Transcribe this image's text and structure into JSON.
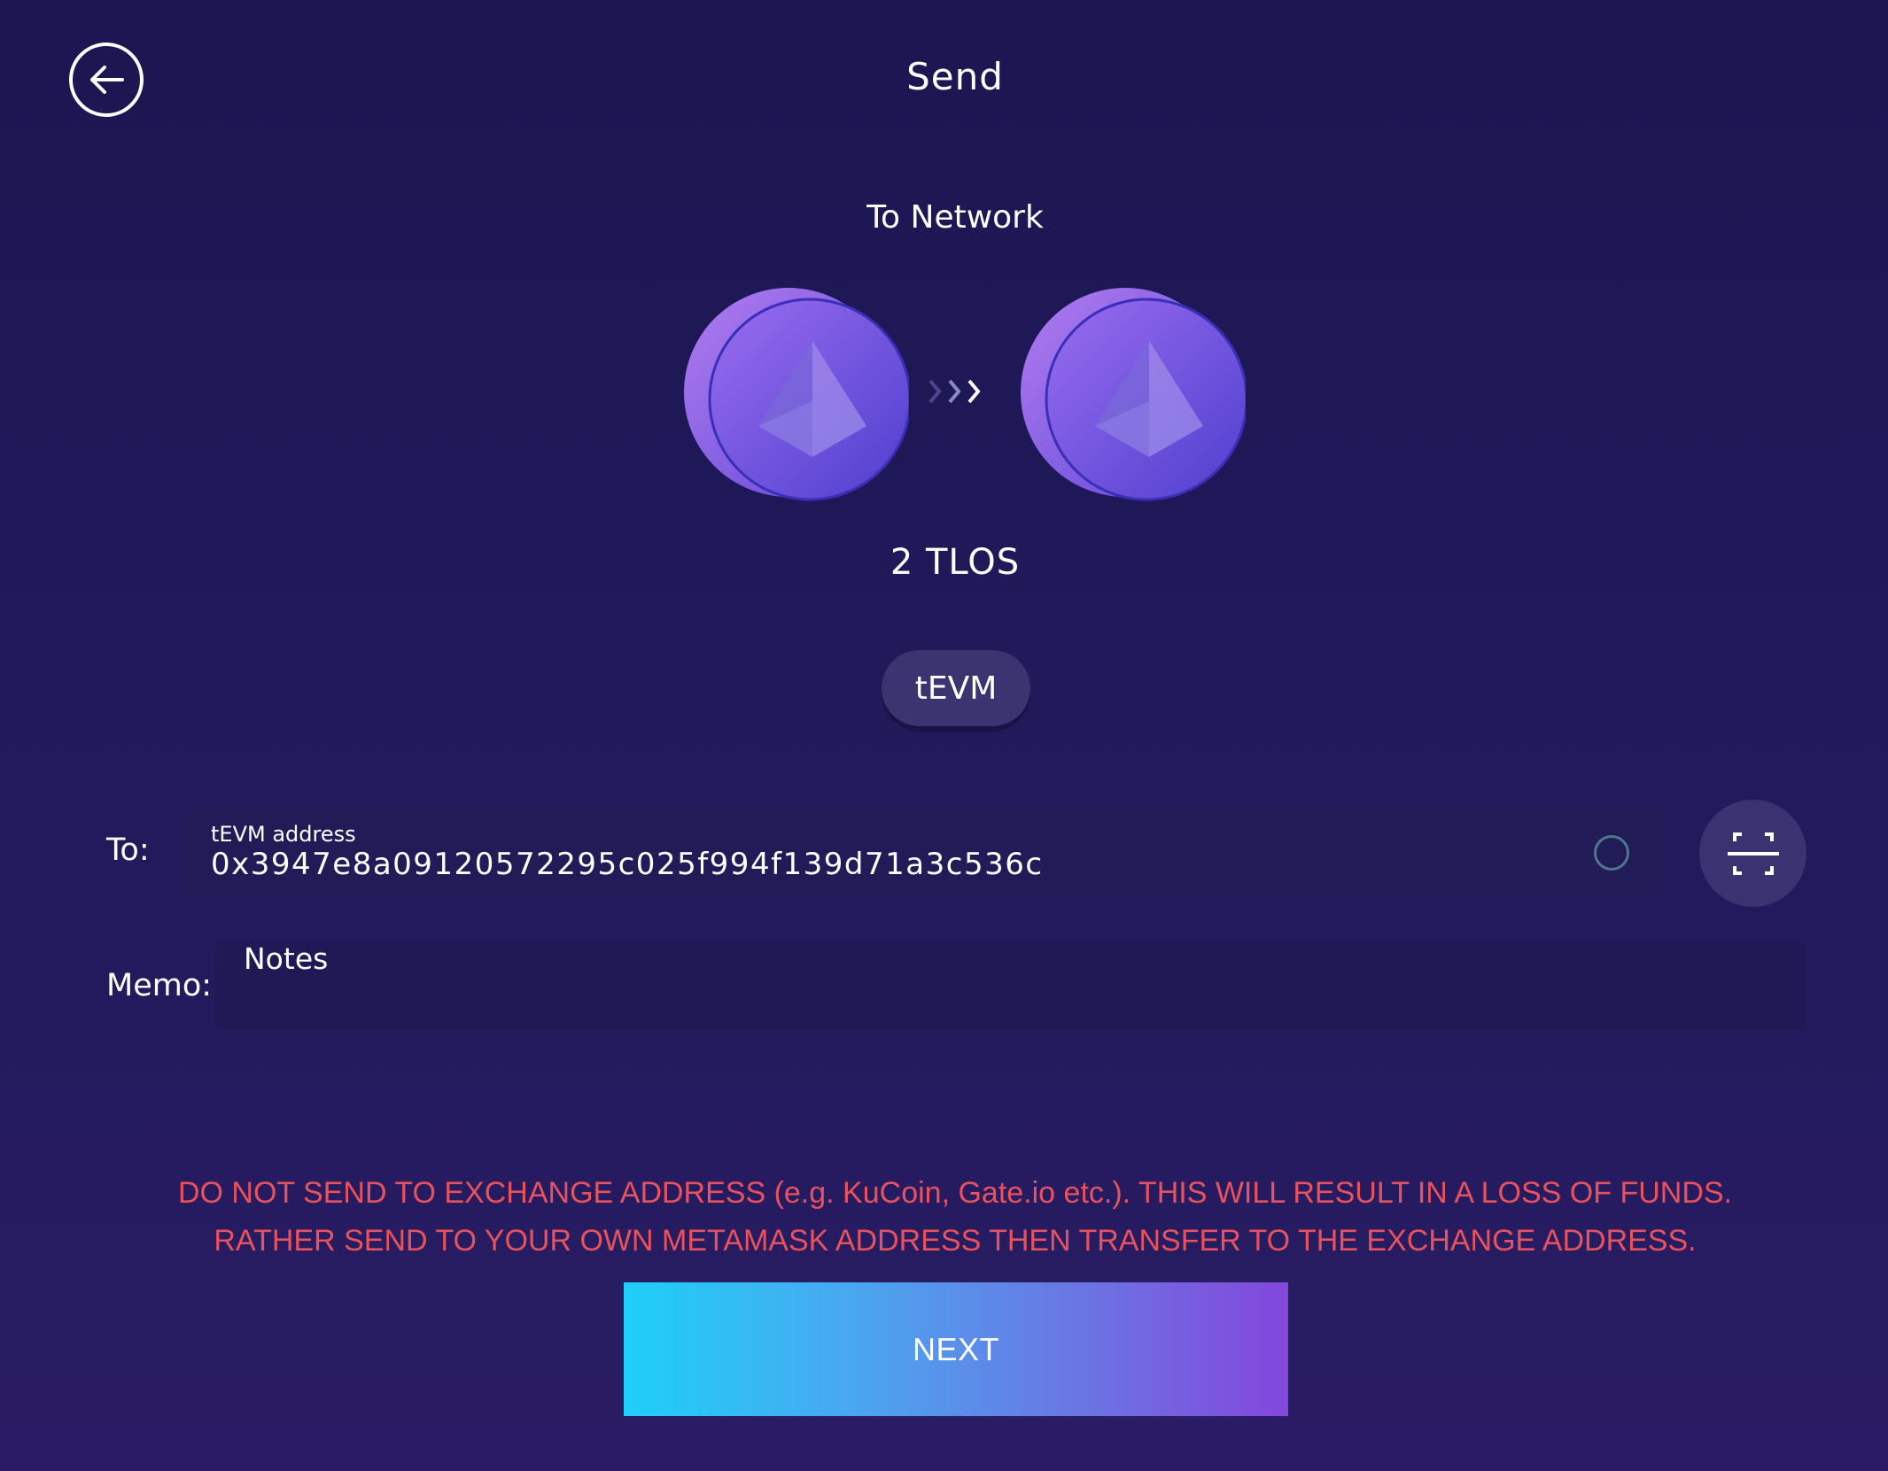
{
  "header": {
    "title": "Send",
    "back_icon": "arrow-left-circle-icon"
  },
  "network": {
    "label": "To Network",
    "from_coin_icon": "ethereum-coin-icon",
    "to_coin_icon": "ethereum-coin-icon",
    "arrow_icon": "triple-chevron-right-icon"
  },
  "amount": "2 TLOS",
  "selected_network": "tEVM",
  "to": {
    "label": "To:",
    "caption": "tEVM address",
    "value": "0x3947e8a09120572295c025f994f139d71a3c536c",
    "scan_icon": "qr-scan-icon",
    "spinner_icon": "loading-spinner-icon"
  },
  "memo": {
    "label": "Memo:",
    "placeholder": "Notes"
  },
  "warning": {
    "line1": "DO NOT SEND TO EXCHANGE ADDRESS (e.g. KuCoin, Gate.io etc.). THIS WILL RESULT IN A LOSS OF FUNDS.",
    "line2": "RATHER SEND TO YOUR OWN METAMASK ADDRESS THEN TRANSFER TO THE EXCHANGE ADDRESS."
  },
  "next_label": "NEXT",
  "colors": {
    "background": "#1c1652",
    "warning": "#e8525c",
    "button_gradient_start": "#1ed0f9",
    "button_gradient_end": "#8447dc",
    "chip": "#3b3470"
  }
}
